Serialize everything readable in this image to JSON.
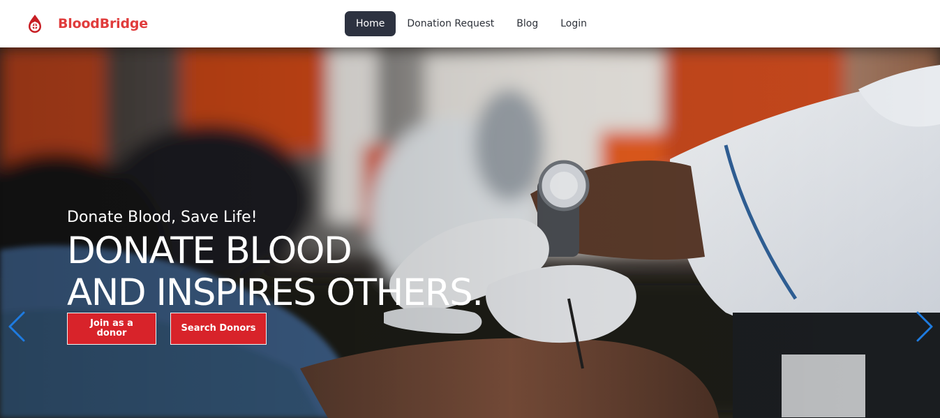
{
  "brand": {
    "name": "BloodBridge",
    "logo_icon": "blood-drop-logo-icon",
    "color": "#e03c3c"
  },
  "nav": {
    "items": [
      {
        "label": "Home",
        "active": true
      },
      {
        "label": "Donation Request",
        "active": false
      },
      {
        "label": "Blog",
        "active": false
      },
      {
        "label": "Login",
        "active": false
      }
    ],
    "active_bg": "#2d3240"
  },
  "hero": {
    "subheading": "Donate Blood, Save Life!",
    "headline_line1": "DONATE BLOOD",
    "headline_line2": "AND INSPIRES OTHERS.",
    "buttons": {
      "join": "Join as a donor",
      "search": "Search Donors"
    },
    "button_color": "#d8232a",
    "carousel": {
      "prev_icon": "chevron-left-icon",
      "next_icon": "chevron-right-icon",
      "arrow_color": "#1e7be0"
    }
  }
}
